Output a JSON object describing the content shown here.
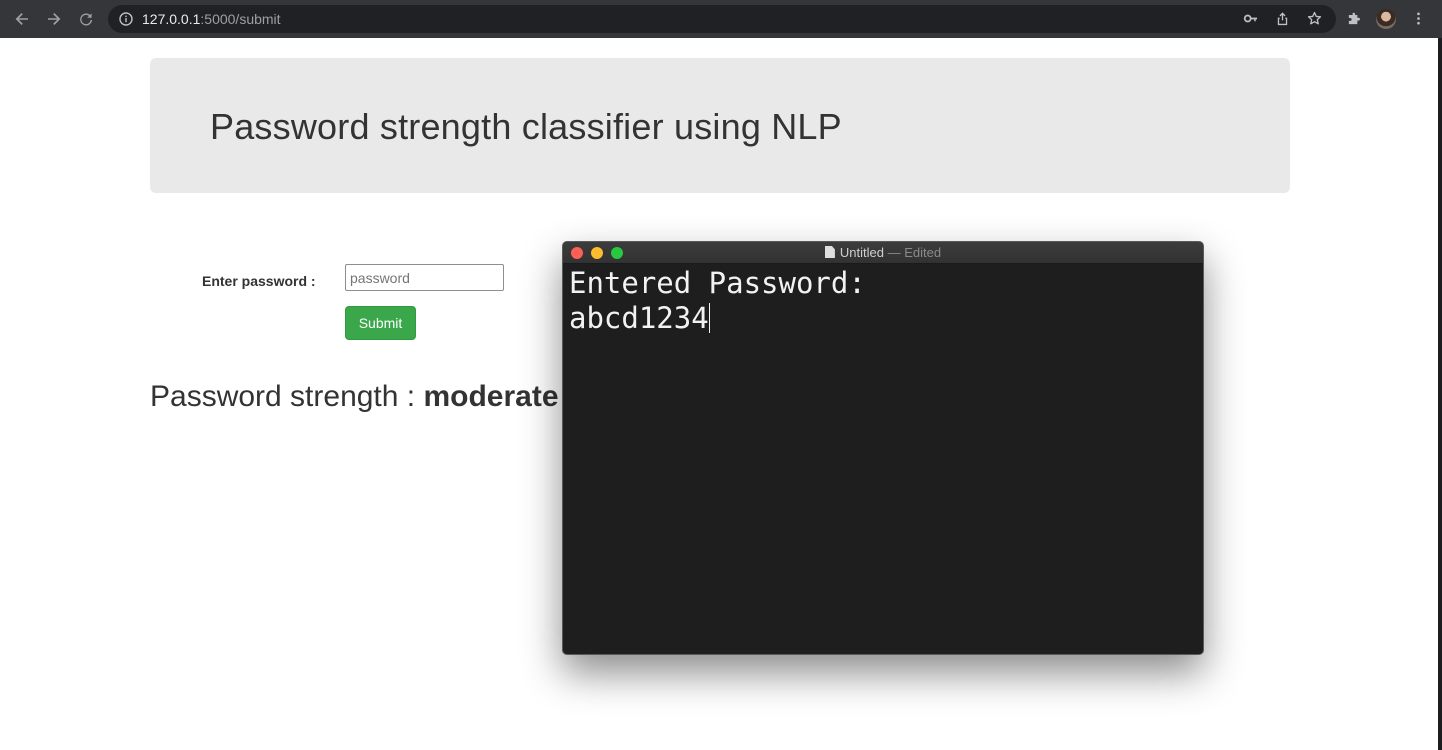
{
  "browser": {
    "url_host": "127.0.0.1",
    "url_rest": ":5000/submit",
    "icons": [
      "back-icon",
      "forward-icon",
      "reload-icon",
      "info-icon",
      "key-icon",
      "share-icon",
      "star-icon",
      "extensions-icon",
      "menu-icon"
    ]
  },
  "page": {
    "title": "Password strength classifier using NLP",
    "form": {
      "label": "Enter password :",
      "placeholder": "password",
      "submit_label": "Submit"
    },
    "result": {
      "prefix": "Password strength : ",
      "value": "moderate"
    },
    "colors": {
      "submit": "#3aa84a",
      "jumbotron": "#e9e9e9"
    }
  },
  "editor": {
    "title": "Untitled",
    "status": "— Edited",
    "line1": "Entered Password:",
    "line2": "abcd1234"
  }
}
